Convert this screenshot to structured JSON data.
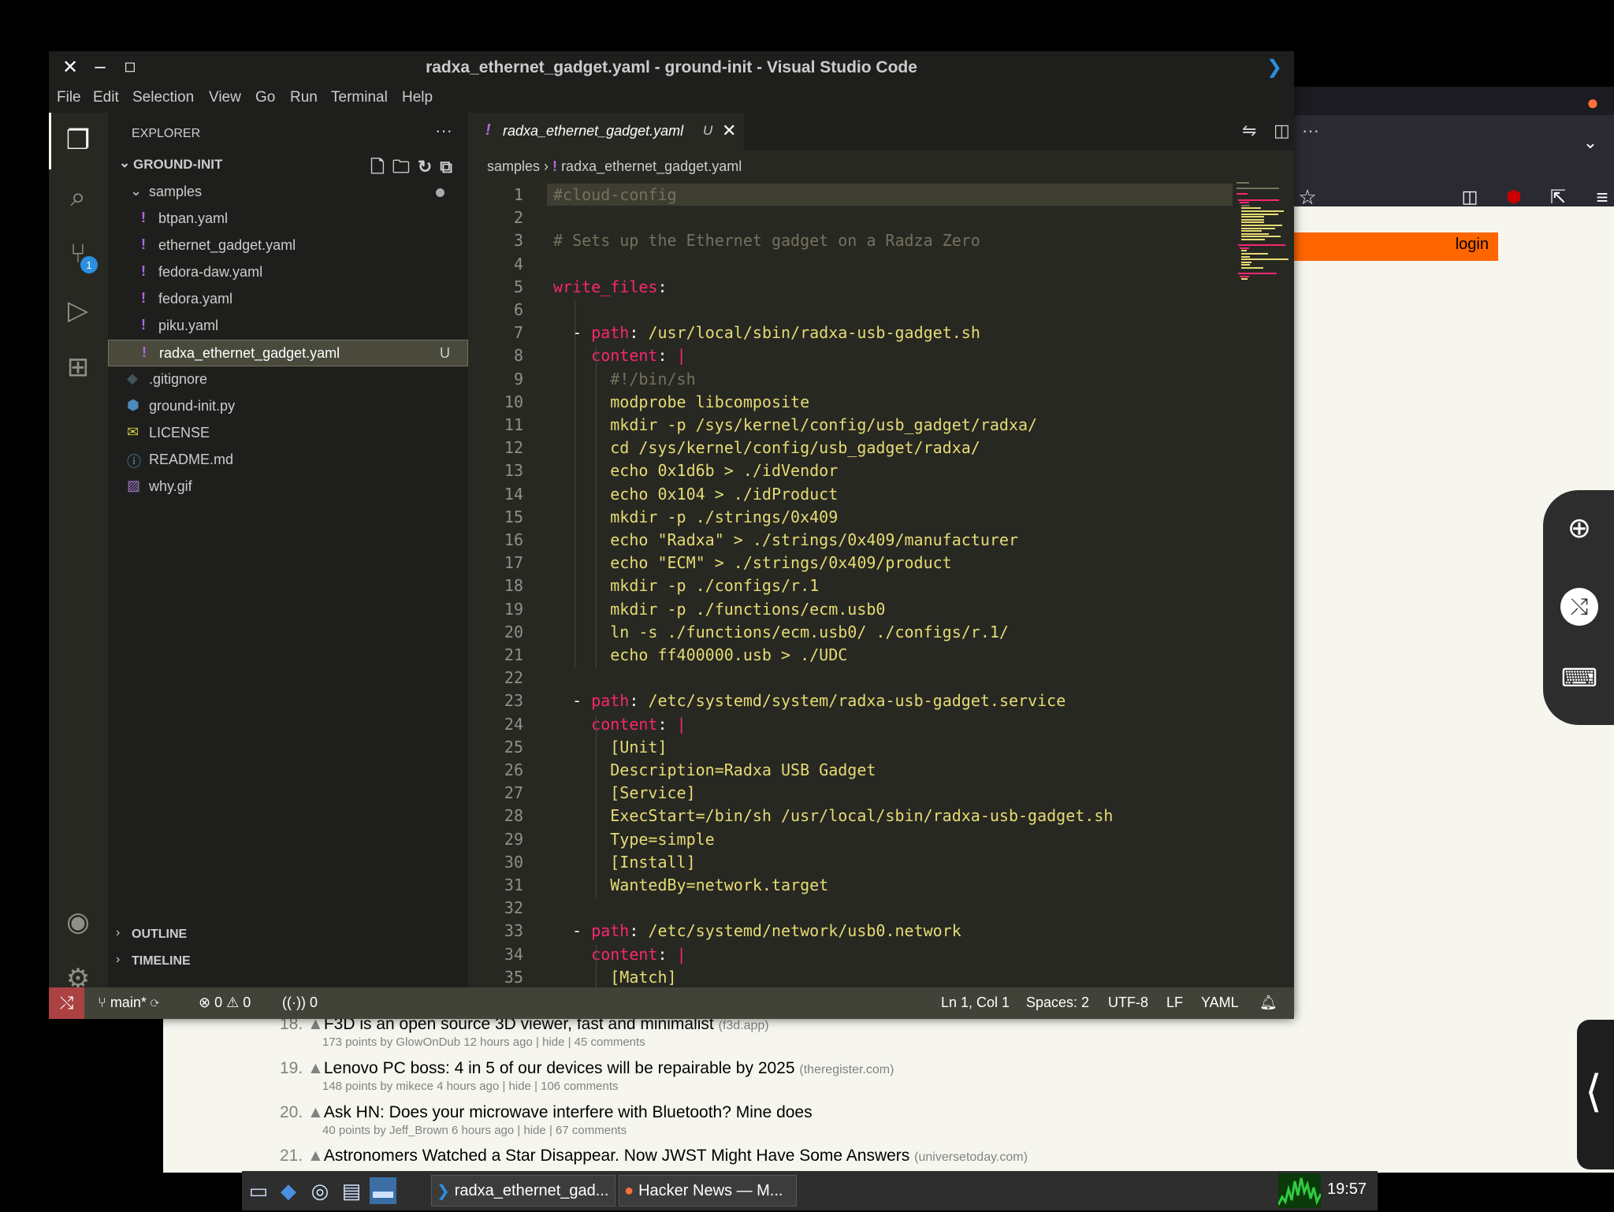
{
  "vscode": {
    "window_title": "radxa_ethernet_gadget.yaml - ground-init - Visual Studio Code",
    "menu": [
      "File",
      "Edit",
      "Selection",
      "View",
      "Go",
      "Run",
      "Terminal",
      "Help"
    ],
    "explorer_title": "EXPLORER",
    "root_folder": "GROUND-INIT",
    "tree": [
      {
        "label": "samples",
        "type": "folder"
      },
      {
        "label": "btpan.yaml",
        "type": "yaml"
      },
      {
        "label": "ethernet_gadget.yaml",
        "type": "yaml"
      },
      {
        "label": "fedora-daw.yaml",
        "type": "yaml"
      },
      {
        "label": "fedora.yaml",
        "type": "yaml"
      },
      {
        "label": "piku.yaml",
        "type": "yaml"
      },
      {
        "label": "radxa_ethernet_gadget.yaml",
        "type": "yaml",
        "badge": "U",
        "selected": true
      },
      {
        "label": ".gitignore",
        "type": "git"
      },
      {
        "label": "ground-init.py",
        "type": "python"
      },
      {
        "label": "LICENSE",
        "type": "license"
      },
      {
        "label": "README.md",
        "type": "info"
      },
      {
        "label": "why.gif",
        "type": "image"
      }
    ],
    "outline_label": "OUTLINE",
    "timeline_label": "TIMELINE",
    "source_control_badge": "1",
    "tab": {
      "label": "radxa_ethernet_gadget.yaml",
      "badge": "U"
    },
    "breadcrumb": {
      "folder": "samples",
      "file": "radxa_ethernet_gadget.yaml"
    },
    "code_lines": [
      "#cloud-config",
      "",
      "# Sets up the Ethernet gadget on a Radza Zero",
      "",
      "write_files:",
      "",
      "  - path: /usr/local/sbin/radxa-usb-gadget.sh",
      "    content: |",
      "      #!/bin/sh",
      "      modprobe libcomposite",
      "      mkdir -p /sys/kernel/config/usb_gadget/radxa/",
      "      cd /sys/kernel/config/usb_gadget/radxa/",
      "      echo 0x1d6b > ./idVendor",
      "      echo 0x104 > ./idProduct",
      "      mkdir -p ./strings/0x409",
      "      echo \"Radxa\" > ./strings/0x409/manufacturer",
      "      echo \"ECM\" > ./strings/0x409/product",
      "      mkdir -p ./configs/r.1",
      "      mkdir -p ./functions/ecm.usb0",
      "      ln -s ./functions/ecm.usb0/ ./configs/r.1/",
      "      echo ff400000.usb > ./UDC",
      "",
      "  - path: /etc/systemd/system/radxa-usb-gadget.service",
      "    content: |",
      "      [Unit]",
      "      Description=Radxa USB Gadget",
      "      [Service]",
      "      ExecStart=/bin/sh /usr/local/sbin/radxa-usb-gadget.sh",
      "      Type=simple",
      "      [Install]",
      "      WantedBy=network.target",
      "",
      "  - path: /etc/systemd/network/usb0.network",
      "    content: |",
      "      [Match]"
    ],
    "status": {
      "branch": "main*",
      "errors": "0",
      "warnings": "0",
      "ports": "0",
      "position": "Ln 1, Col 1",
      "spaces": "Spaces: 2",
      "encoding": "UTF-8",
      "eol": "LF",
      "language": "YAML"
    }
  },
  "firefox": {
    "login": "login",
    "hn_items": [
      {
        "num": "18.",
        "title": "F3D is an open source 3D viewer, fast and minimalist",
        "site": "(f3d.app)",
        "sub": "173 points by GlowOnDub 12 hours ago | hide | 45 comments"
      },
      {
        "num": "19.",
        "title": "Lenovo PC boss: 4 in 5 of our devices will be repairable by 2025",
        "site": "(theregister.com)",
        "sub": "148 points by mikece 4 hours ago | hide | 106 comments"
      },
      {
        "num": "20.",
        "title": "Ask HN: Does your microwave interfere with Bluetooth? Mine does",
        "site": "",
        "sub": "40 points by Jeff_Brown 6 hours ago | hide | 67 comments"
      },
      {
        "num": "21.",
        "title": "Astronomers Watched a Star Disappear. Now JWST Might Have Some Answers",
        "site": "(universetoday.com)",
        "sub": ""
      }
    ]
  },
  "taskbar": {
    "tasks": [
      {
        "label": "radxa_ethernet_gad..."
      },
      {
        "label": "Hacker News — M..."
      }
    ],
    "clock": "19:57"
  }
}
